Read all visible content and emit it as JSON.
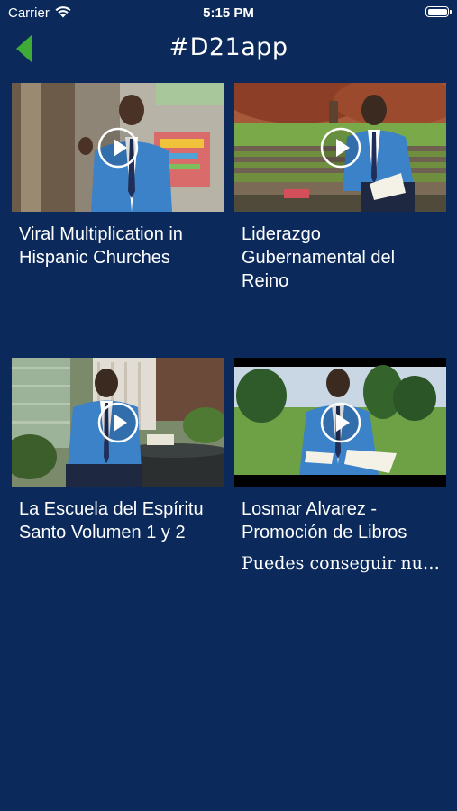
{
  "status": {
    "carrier": "Carrier",
    "time": "5:15 PM"
  },
  "nav": {
    "title": "#D21app",
    "back_icon": "chevron-left-icon",
    "accent_color": "#3faa35"
  },
  "videos": [
    {
      "title": "Viral Multiplication in Hispanic Churches",
      "description": ""
    },
    {
      "title": "Liderazgo Gubernamental del Reino",
      "description": ""
    },
    {
      "title": "La Escuela del Espíritu Santo Volumen 1 y 2",
      "description": ""
    },
    {
      "title": "Losmar Alvarez - Promoción de Libros",
      "description": "Puedes conseguir nuestro libros y llena..."
    }
  ],
  "colors": {
    "background": "#0b2a5b",
    "text": "#ffffff"
  }
}
